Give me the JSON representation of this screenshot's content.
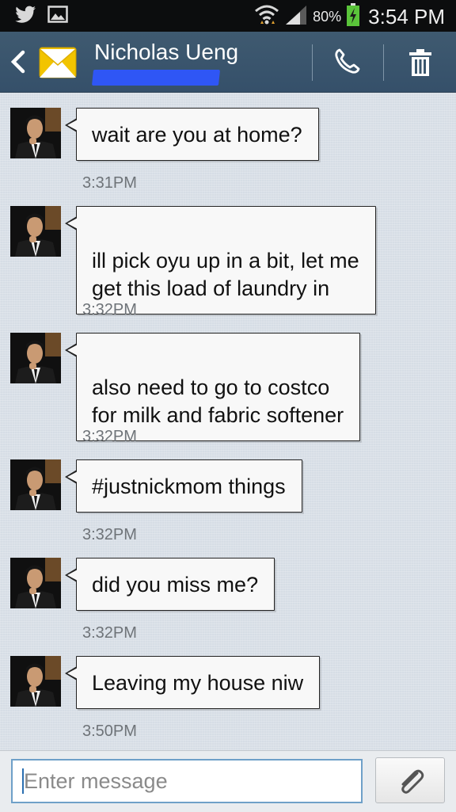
{
  "status_bar": {
    "battery_percent": "80%",
    "time": "3:54 PM",
    "icons": [
      "twitter-icon",
      "image-icon",
      "wifi-icon",
      "signal-icon",
      "battery-charging-icon"
    ]
  },
  "header": {
    "contact_name": "Nicholas Ueng",
    "icons": [
      "back-icon",
      "mail-icon",
      "phone-icon",
      "trash-icon"
    ],
    "colors": {
      "background": "#3a566d",
      "redaction": "#2f56f5"
    }
  },
  "messages": [
    {
      "text": "wait are you at home?",
      "time": "3:31PM"
    },
    {
      "text": "ill pick oyu up in a bit, let me\nget this load of laundry in",
      "time": "3:32PM"
    },
    {
      "text": "also need to go to costco\nfor milk and fabric softener",
      "time": "3:32PM"
    },
    {
      "text": "#justnickmom things",
      "time": "3:32PM"
    },
    {
      "text": "did you miss me?",
      "time": "3:32PM"
    },
    {
      "text": "Leaving my house niw",
      "time": "3:50PM"
    }
  ],
  "composer": {
    "placeholder": "Enter message",
    "value": "",
    "attach_icon": "paperclip-icon"
  }
}
